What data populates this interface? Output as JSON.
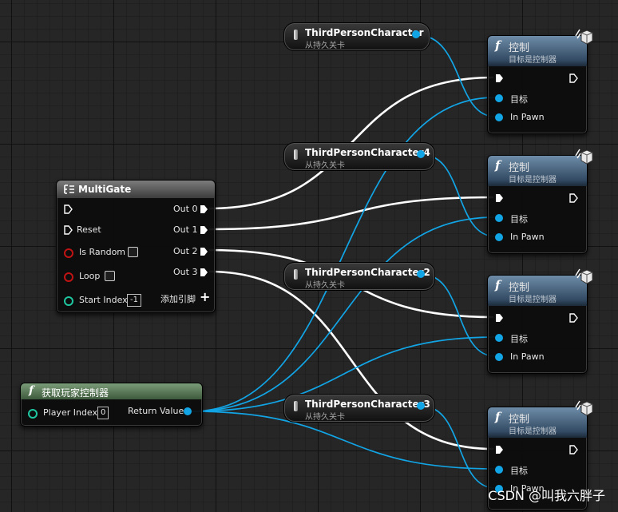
{
  "multigate": {
    "title": "MultiGate",
    "reset": "Reset",
    "is_random": "Is Random",
    "loop": "Loop",
    "start_index": "Start Index",
    "start_index_value": "-1",
    "outputs": [
      "Out 0",
      "Out 1",
      "Out 2",
      "Out 3"
    ],
    "add_pin": "添加引脚"
  },
  "get_controller": {
    "title": "获取玩家控制器",
    "player_index": "Player Index",
    "player_index_value": "0",
    "return_value": "Return Value"
  },
  "variables": [
    {
      "name": "ThirdPersonCharacter",
      "sub": "从持久关卡"
    },
    {
      "name": "ThirdPersonCharacter4",
      "sub": "从持久关卡"
    },
    {
      "name": "ThirdPersonCharacter2",
      "sub": "从持久关卡"
    },
    {
      "name": "ThirdPersonCharacter3",
      "sub": "从持久关卡"
    }
  ],
  "possess_nodes": [
    {
      "title": "控制",
      "sub": "目标是控制器",
      "target": "目标",
      "pawn": "In Pawn"
    },
    {
      "title": "控制",
      "sub": "目标是控制器",
      "target": "目标",
      "pawn": "In Pawn"
    },
    {
      "title": "控制",
      "sub": "目标是控制器",
      "target": "目标",
      "pawn": "In Pawn"
    },
    {
      "title": "控制",
      "sub": "目标是控制器",
      "target": "目标",
      "pawn": "In Pawn"
    }
  ],
  "icons": {
    "function": "f",
    "add": "+"
  },
  "colors": {
    "exec": "#ffffff",
    "object_pin": "#12a5e6",
    "int_pin": "#1fc7a0",
    "bool_pin": "#c01313",
    "function_header": "#4d6a86",
    "pure_header": "#5a7a58"
  },
  "watermark": "CSDN @叫我六胖子"
}
